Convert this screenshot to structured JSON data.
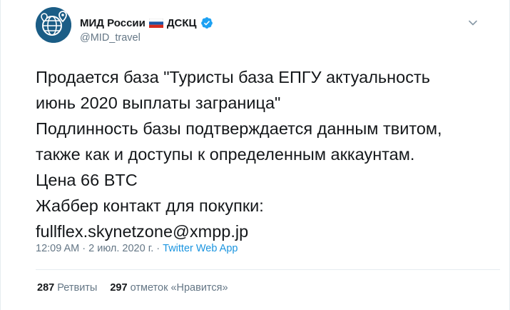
{
  "tweet": {
    "author": {
      "display_name": "МИД России",
      "flag_icon": "russia-flag-icon",
      "name_suffix": "ДСКЦ",
      "verified_icon": "verified-badge-icon",
      "handle": "@MID_travel",
      "avatar_icon": "globe-pins-icon"
    },
    "menu_icon": "chevron-down-icon",
    "text_lines": [
      "Продается база \"Туристы база ЕПГУ актуальность",
      "июнь 2020 выплаты заграница\"",
      "Подлинность базы подтверждается данным твитом,",
      "также как и доступы к определенным аккаунтам.",
      "Цена 66 BTC",
      "Жаббер контакт для покупки:",
      "fullflex.skynetzone@xmpp.jp"
    ],
    "time": "12:09 AM",
    "separator": " · ",
    "date": "2 июл. 2020 г.",
    "source": "Twitter Web App",
    "retweets_count": "287",
    "retweets_label": "Ретвиты",
    "likes_count": "297",
    "likes_label": "отметок «Нравится»"
  },
  "colors": {
    "text": "#14171a",
    "secondary": "#657786",
    "link": "#1b95e0",
    "verified": "#1da1f2",
    "avatar_bg": "#1b5d86"
  }
}
